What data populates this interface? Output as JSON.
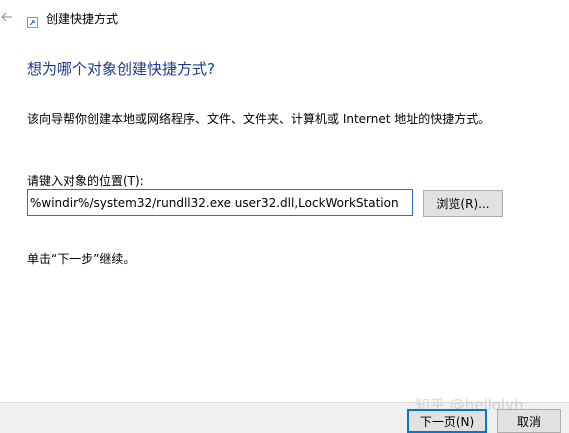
{
  "window": {
    "title": "创建快捷方式",
    "back_icon": "back-arrow-icon",
    "title_icon": "shortcut-icon"
  },
  "main": {
    "heading": "想为哪个对象创建快捷方式?",
    "description": "该向导帮你创建本地或网络程序、文件、文件夹、计算机或 Internet 地址的快捷方式。",
    "location_label": "请键入对象的位置(T):",
    "location_value": "%windir%/system32/rundll32.exe user32.dll,LockWorkStation",
    "browse_label": "浏览(R)...",
    "hint": "单击“下一步”继续。"
  },
  "footer": {
    "next_label": "下一页(N)",
    "cancel_label": "取消"
  },
  "watermark": "知乎 @hellolyh",
  "colors": {
    "heading": "#1a3c8c",
    "input_border": "#2a6fd6",
    "default_button_border": "#0078d7",
    "footer_bg": "#f0f0f0"
  }
}
